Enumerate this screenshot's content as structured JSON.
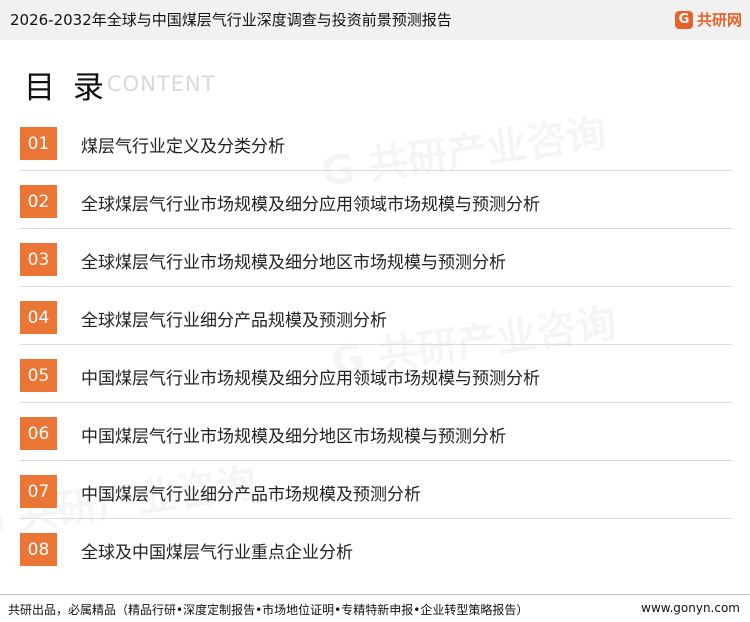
{
  "header": {
    "title": "2026-2032年全球与中国煤层气行业深度调查与投资前景预测报告",
    "logo_mark": "G",
    "logo_text": "共研网"
  },
  "heading": {
    "title": "目 录",
    "subtitle": "CONTENT"
  },
  "toc": [
    {
      "num": "01",
      "label": "煤层气行业定义及分类分析"
    },
    {
      "num": "02",
      "label": "全球煤层气行业市场规模及细分应用领域市场规模与预测分析"
    },
    {
      "num": "03",
      "label": "全球煤层气行业市场规模及细分地区市场规模与预测分析"
    },
    {
      "num": "04",
      "label": "全球煤层气行业细分产品规模及预测分析"
    },
    {
      "num": "05",
      "label": "中国煤层气行业市场规模及细分应用领域市场规模与预测分析"
    },
    {
      "num": "06",
      "label": "中国煤层气行业市场规模及细分地区市场规模与预测分析"
    },
    {
      "num": "07",
      "label": "中国煤层气行业细分产品市场规模及预测分析"
    },
    {
      "num": "08",
      "label": "全球及中国煤层气行业重点企业分析"
    }
  ],
  "footer": {
    "left": "共研出品，必属精品（精品行研•深度定制报告•市场地位证明•专精特新申报•企业转型策略报告）",
    "right": "www.gonyn.com"
  },
  "watermark": {
    "text": "G 共研产业咨询"
  }
}
